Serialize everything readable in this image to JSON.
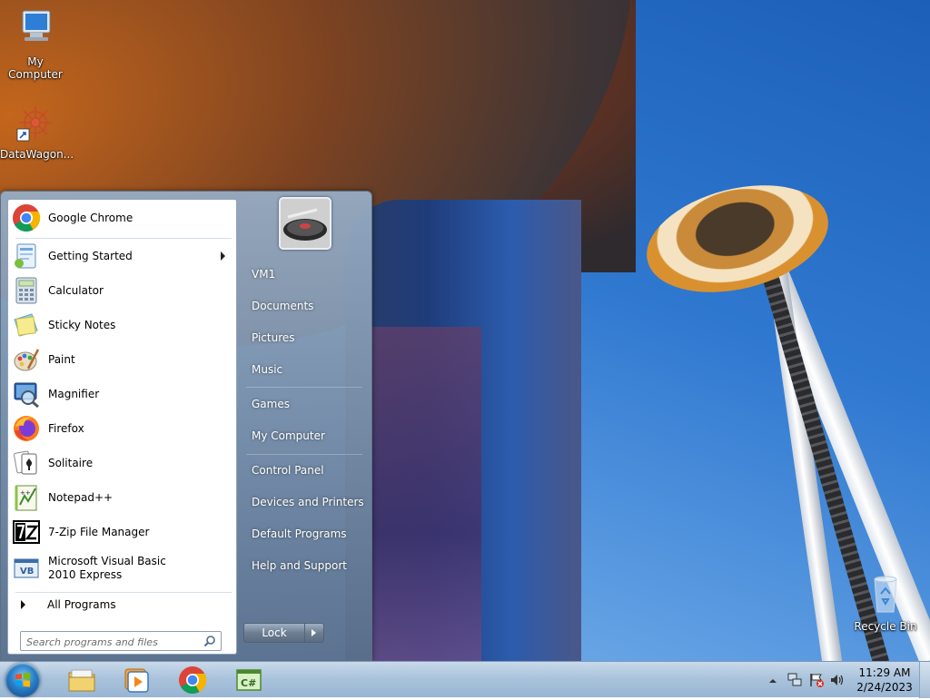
{
  "desktop": {
    "icons": [
      {
        "label": "My Computer",
        "icon": "computer-icon"
      },
      {
        "label": "DataWagon...",
        "icon": "datawagon-icon"
      },
      {
        "label": "Recycle Bin",
        "icon": "recycle-bin-icon"
      }
    ]
  },
  "start_menu": {
    "programs": [
      {
        "label": "Google Chrome",
        "icon": "chrome-icon",
        "submenu": false
      },
      {
        "label": "Getting Started",
        "icon": "getting-started-icon",
        "submenu": true
      },
      {
        "label": "Calculator",
        "icon": "calculator-icon",
        "submenu": false
      },
      {
        "label": "Sticky Notes",
        "icon": "sticky-notes-icon",
        "submenu": false
      },
      {
        "label": "Paint",
        "icon": "paint-icon",
        "submenu": false
      },
      {
        "label": "Magnifier",
        "icon": "magnifier-icon",
        "submenu": false
      },
      {
        "label": "Firefox",
        "icon": "firefox-icon",
        "submenu": false
      },
      {
        "label": "Solitaire",
        "icon": "solitaire-icon",
        "submenu": false
      },
      {
        "label": "Notepad++",
        "icon": "notepad-plus-plus-icon",
        "submenu": false
      },
      {
        "label": "7-Zip File Manager",
        "icon": "7zip-icon",
        "submenu": false
      },
      {
        "label": "Microsoft Visual Basic 2010 Express",
        "icon": "visual-basic-icon",
        "submenu": false
      }
    ],
    "all_programs_label": "All Programs",
    "search_placeholder": "Search programs and files",
    "right_items": [
      "VM1",
      "Documents",
      "Pictures",
      "Music",
      "Games",
      "My Computer",
      "Control Panel",
      "Devices and Printers",
      "Default Programs",
      "Help and Support"
    ],
    "lock_label": "Lock"
  },
  "taskbar": {
    "pinned": [
      {
        "name": "windows-explorer",
        "icon": "folder-icon"
      },
      {
        "name": "media-player",
        "icon": "media-player-icon"
      },
      {
        "name": "google-chrome",
        "icon": "chrome-icon"
      },
      {
        "name": "visual-csharp",
        "icon": "csharp-icon"
      }
    ],
    "tray_icons": [
      "show-hidden-icons-icon",
      "network-icon",
      "action-center-icon",
      "volume-icon"
    ],
    "clock_time": "11:29 AM",
    "clock_date": "2/24/2023"
  }
}
